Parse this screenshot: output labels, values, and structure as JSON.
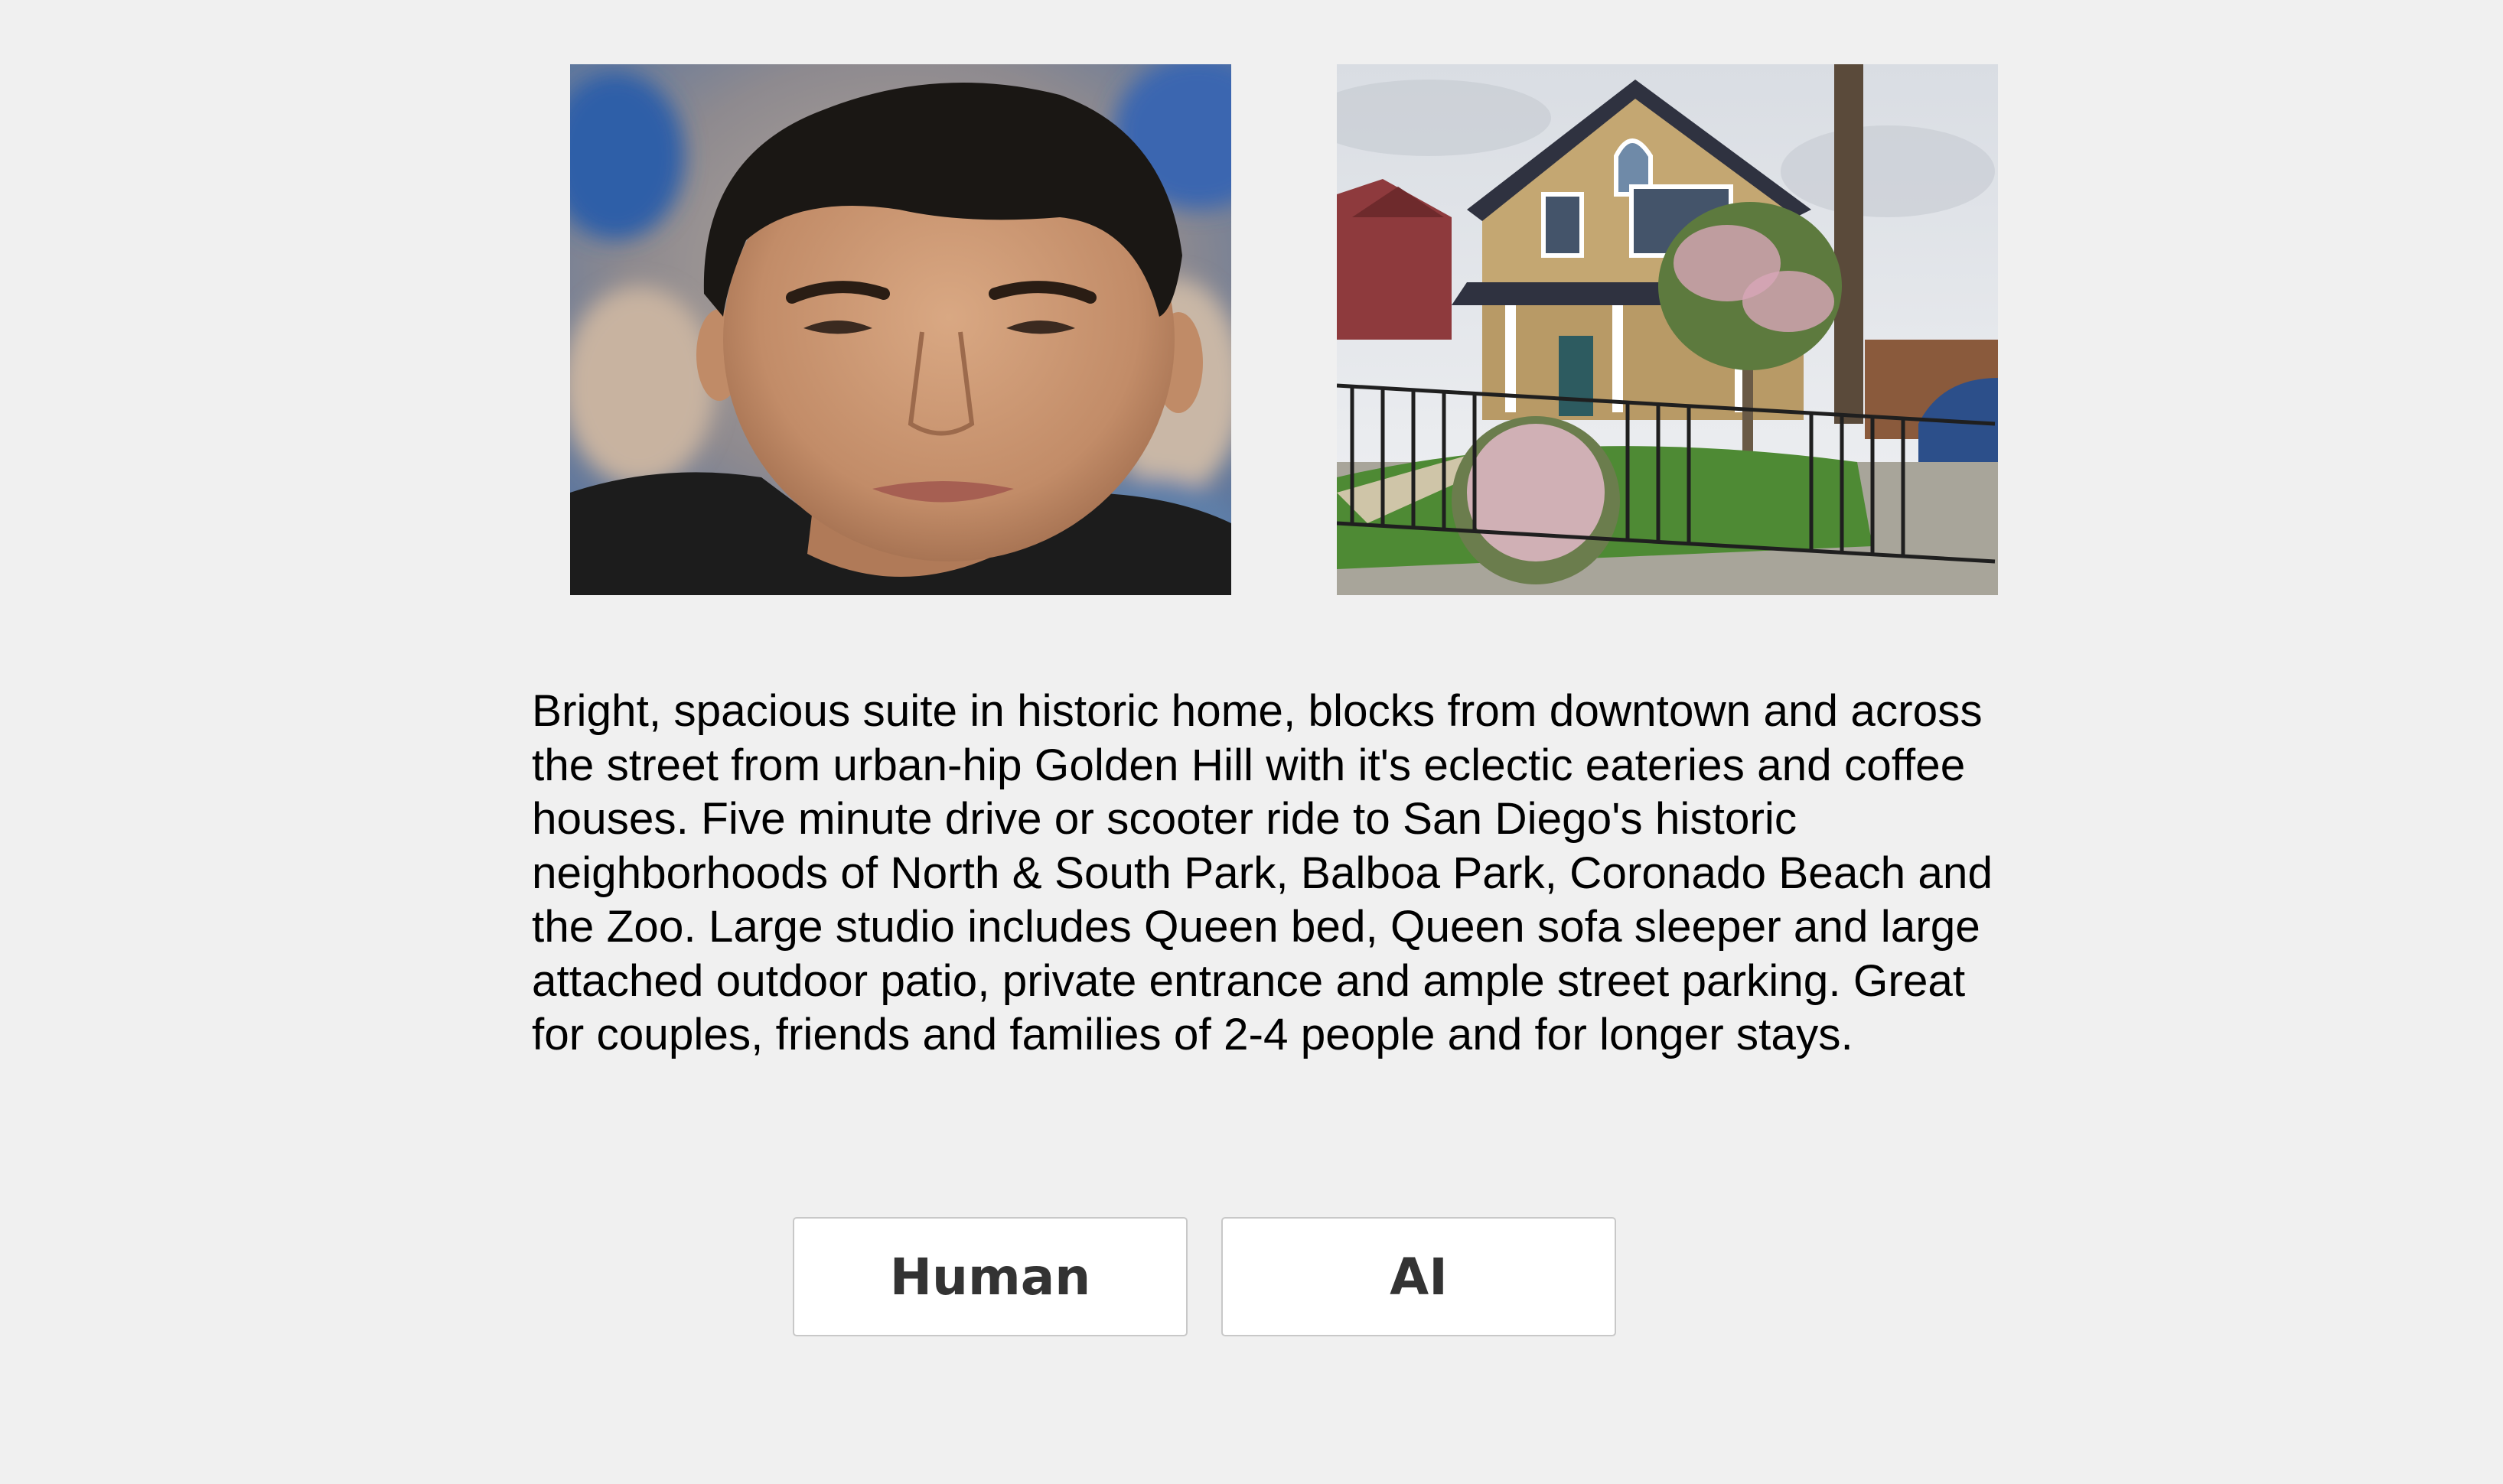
{
  "images": {
    "host_photo": {
      "alt": "host-portrait"
    },
    "house_photo": {
      "alt": "listing-house"
    }
  },
  "description": "Bright, spacious suite in historic home, blocks from downtown and across the street from urban-hip Golden Hill with it's eclectic eateries and coffee houses. Five minute drive or scooter ride to San Diego's historic neighborhoods of North & South Park, Balboa Park, Coronado Beach and the Zoo. Large studio includes Queen bed, Queen sofa sleeper and large attached outdoor patio, private entrance and ample street parking. Great for couples, friends and families of 2-4 people and for longer stays.",
  "buttons": {
    "human_label": "Human",
    "ai_label": "AI"
  },
  "colors": {
    "page_background": "#f0f0f0",
    "button_background": "#ffffff",
    "button_border": "#c8c8c8",
    "button_text": "#333333",
    "body_text": "#000000"
  }
}
